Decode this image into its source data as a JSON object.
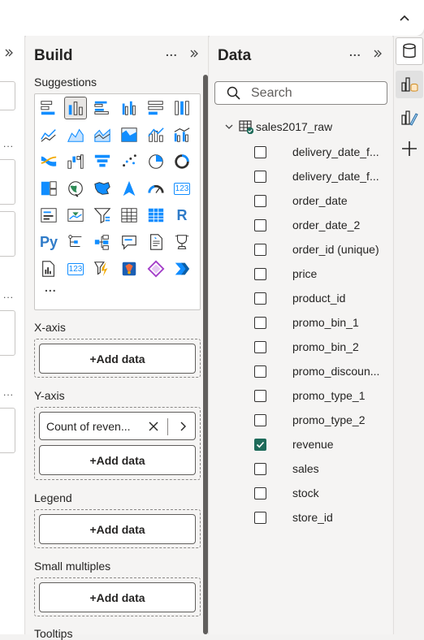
{
  "build": {
    "title": "Build",
    "more_label": "...",
    "suggestions_label": "Suggestions",
    "viz_more": "...",
    "wells": [
      {
        "label": "X-axis",
        "add": "+Add data"
      },
      {
        "label": "Y-axis",
        "field": "Count of reven...",
        "add": "+Add data"
      },
      {
        "label": "Legend",
        "add": "+Add data"
      },
      {
        "label": "Small multiples",
        "add": "+Add data"
      }
    ],
    "tooltips_label": "Tooltips",
    "visuals": [
      {
        "name": "stacked-bar-chart-icon",
        "glyph": "",
        "selected": false
      },
      {
        "name": "stacked-column-chart-icon",
        "glyph": "",
        "selected": true
      },
      {
        "name": "clustered-bar-chart-icon",
        "glyph": "",
        "selected": false
      },
      {
        "name": "clustered-column-chart-icon",
        "glyph": "",
        "selected": false
      },
      {
        "name": "100-stacked-bar-chart-icon",
        "glyph": "",
        "selected": false
      },
      {
        "name": "100-stacked-column-chart-icon",
        "glyph": "",
        "selected": false
      },
      {
        "name": "line-chart-icon",
        "glyph": "",
        "selected": false
      },
      {
        "name": "area-chart-icon",
        "glyph": "",
        "selected": false
      },
      {
        "name": "stacked-area-chart-icon",
        "glyph": "",
        "selected": false
      },
      {
        "name": "100-stacked-area-chart-icon",
        "glyph": "",
        "selected": false
      },
      {
        "name": "line-and-stacked-column-chart-icon",
        "glyph": "",
        "selected": false
      },
      {
        "name": "line-and-clustered-column-chart-icon",
        "glyph": "",
        "selected": false
      },
      {
        "name": "ribbon-chart-icon",
        "glyph": "",
        "selected": false
      },
      {
        "name": "waterfall-chart-icon",
        "glyph": "",
        "selected": false
      },
      {
        "name": "funnel-chart-icon",
        "glyph": "",
        "selected": false
      },
      {
        "name": "scatter-chart-icon",
        "glyph": "",
        "selected": false
      },
      {
        "name": "pie-chart-icon",
        "glyph": "",
        "selected": false
      },
      {
        "name": "donut-chart-icon",
        "glyph": "",
        "selected": false
      },
      {
        "name": "treemap-icon",
        "glyph": "",
        "selected": false
      },
      {
        "name": "map-icon",
        "glyph": "",
        "selected": false
      },
      {
        "name": "filled-map-icon",
        "glyph": "",
        "selected": false
      },
      {
        "name": "azure-map-icon",
        "glyph": "",
        "selected": false
      },
      {
        "name": "gauge-icon",
        "glyph": "",
        "selected": false
      },
      {
        "name": "card-icon",
        "glyph": "123",
        "selected": false
      },
      {
        "name": "multi-row-card-icon",
        "glyph": "",
        "selected": false
      },
      {
        "name": "kpi-icon",
        "glyph": "",
        "selected": false
      },
      {
        "name": "slicer-icon",
        "glyph": "",
        "selected": false
      },
      {
        "name": "table-icon",
        "glyph": "",
        "selected": false
      },
      {
        "name": "matrix-icon",
        "glyph": "",
        "selected": false
      },
      {
        "name": "r-script-visual-icon",
        "glyph": "R",
        "selected": false
      },
      {
        "name": "python-visual-icon",
        "glyph": "Py",
        "selected": false
      },
      {
        "name": "key-influencers-icon",
        "glyph": "",
        "selected": false
      },
      {
        "name": "decomposition-tree-icon",
        "glyph": "",
        "selected": false
      },
      {
        "name": "qa-visual-icon",
        "glyph": "",
        "selected": false
      },
      {
        "name": "smart-narrative-icon",
        "glyph": "",
        "selected": false
      },
      {
        "name": "goals-icon",
        "glyph": "",
        "selected": false
      },
      {
        "name": "paginated-report-icon",
        "glyph": "",
        "selected": false
      },
      {
        "name": "new-card-icon",
        "glyph": "123",
        "selected": false
      },
      {
        "name": "new-slicer-icon",
        "glyph": "",
        "selected": false
      },
      {
        "name": "power-apps-icon",
        "glyph": "",
        "selected": false
      },
      {
        "name": "power-automate-icon",
        "glyph": "",
        "selected": false
      },
      {
        "name": "power-automate-flow-icon",
        "glyph": "",
        "selected": false
      }
    ]
  },
  "data": {
    "title": "Data",
    "more_label": "...",
    "search_placeholder": "Search",
    "table_name": "sales2017_raw",
    "fields": [
      {
        "name": "delivery_date_f...",
        "checked": false
      },
      {
        "name": "delivery_date_f...",
        "checked": false
      },
      {
        "name": "order_date",
        "checked": false
      },
      {
        "name": "order_date_2",
        "checked": false
      },
      {
        "name": "order_id (unique)",
        "checked": false
      },
      {
        "name": "price",
        "checked": false
      },
      {
        "name": "product_id",
        "checked": false
      },
      {
        "name": "promo_bin_1",
        "checked": false
      },
      {
        "name": "promo_bin_2",
        "checked": false
      },
      {
        "name": "promo_discoun...",
        "checked": false
      },
      {
        "name": "promo_type_1",
        "checked": false
      },
      {
        "name": "promo_type_2",
        "checked": false
      },
      {
        "name": "revenue",
        "checked": true
      },
      {
        "name": "sales",
        "checked": false
      },
      {
        "name": "stock",
        "checked": false
      },
      {
        "name": "store_id",
        "checked": false
      }
    ]
  },
  "rail": {
    "buttons": [
      "data-pane-icon",
      "build-pane-icon",
      "format-pane-icon",
      "add-pane-icon"
    ]
  },
  "left_panel": {
    "dots": "..."
  },
  "colors": {
    "accent": "#118dff",
    "check": "#1e6b5a",
    "model_badge": "#1e6b5a"
  }
}
